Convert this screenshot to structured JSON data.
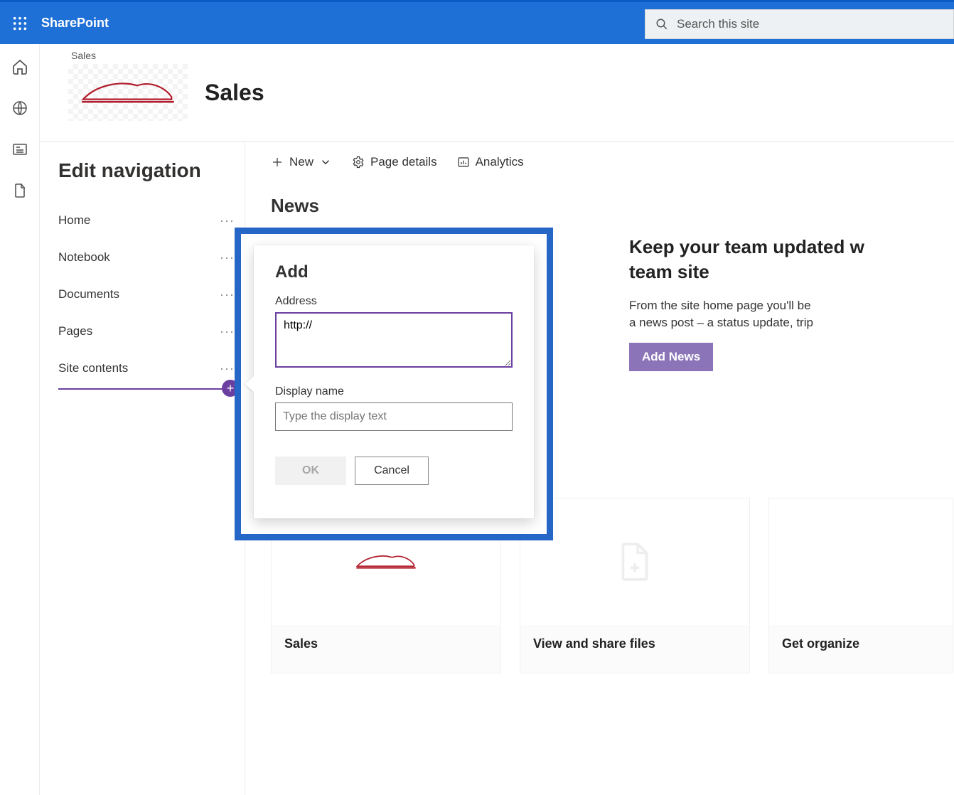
{
  "suite": {
    "product": "SharePoint",
    "search_placeholder": "Search this site"
  },
  "site": {
    "breadcrumb": "Sales",
    "title": "Sales"
  },
  "nav_panel": {
    "title": "Edit navigation",
    "items": [
      {
        "label": "Home"
      },
      {
        "label": "Notebook"
      },
      {
        "label": "Documents"
      },
      {
        "label": "Pages"
      },
      {
        "label": "Site contents"
      }
    ]
  },
  "commands": {
    "new": "New",
    "page_details": "Page details",
    "analytics": "Analytics"
  },
  "news": {
    "section": "News",
    "heading": "Keep your team updated w\nteam site",
    "body": "From the site home page you'll be\na news post – a status update, trip",
    "button": "Add News"
  },
  "activity": {
    "card1_title": "Sales",
    "card2_title": "View and share files",
    "card3_title": "Get organize"
  },
  "dialog": {
    "title": "Add",
    "address_label": "Address",
    "address_value": "http://",
    "display_label": "Display name",
    "display_placeholder": "Type the display text",
    "ok": "OK",
    "cancel": "Cancel"
  }
}
